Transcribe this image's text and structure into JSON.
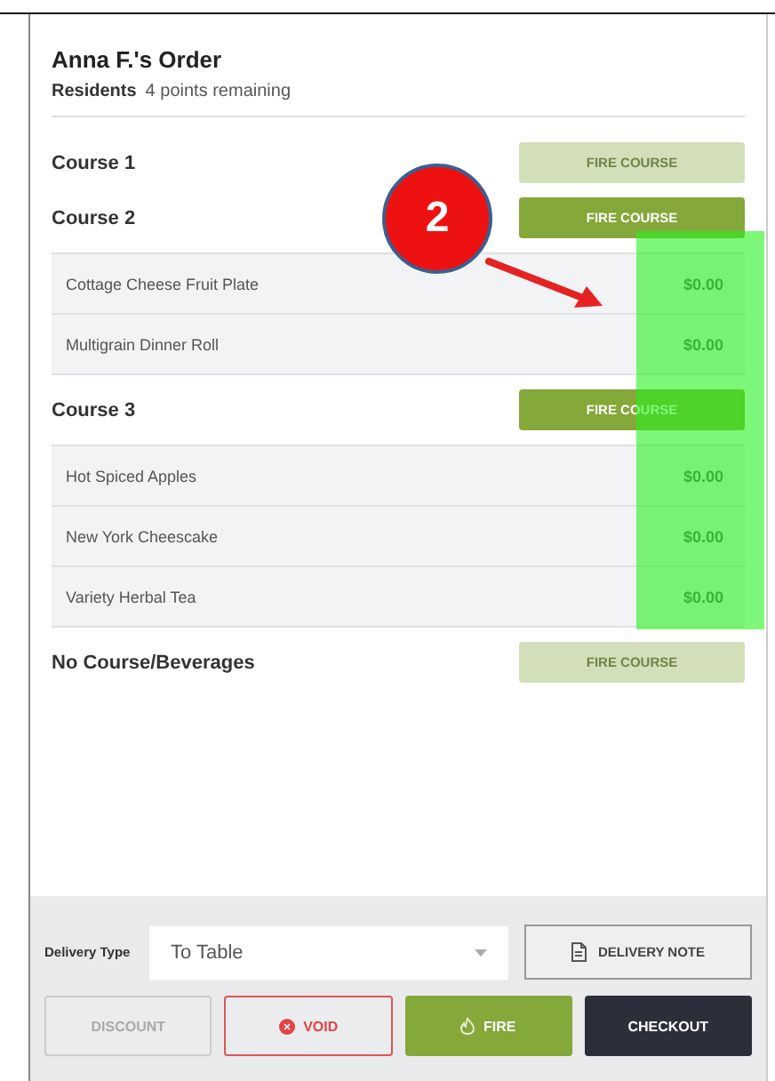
{
  "order": {
    "title": "Anna F.'s Order",
    "group": "Residents",
    "points": "4 points remaining"
  },
  "courses": [
    {
      "name": "Course 1",
      "button": "FIRE COURSE",
      "enabled": false
    },
    {
      "name": "Course 2",
      "button": "FIRE COURSE",
      "enabled": true,
      "items": [
        {
          "name": "Cottage Cheese Fruit Plate",
          "price": "$0.00"
        },
        {
          "name": "Multigrain Dinner Roll",
          "price": "$0.00"
        }
      ]
    },
    {
      "name": "Course 3",
      "button": "FIRE COURSE",
      "enabled": true,
      "items": [
        {
          "name": "Hot Spiced Apples",
          "price": "$0.00"
        },
        {
          "name": "New York Cheescake",
          "price": "$0.00"
        },
        {
          "name": "Variety Herbal Tea",
          "price": "$0.00"
        }
      ]
    },
    {
      "name": "No Course/Beverages",
      "button": "FIRE COURSE",
      "enabled": false
    }
  ],
  "delivery": {
    "label": "Delivery Type",
    "value": "To Table",
    "note_button": "DELIVERY NOTE"
  },
  "actions": [
    {
      "kind": "discount",
      "label": "DISCOUNT",
      "disabled": true
    },
    {
      "kind": "void",
      "label": "VOID",
      "disabled": false
    },
    {
      "kind": "fire",
      "label": "FIRE",
      "disabled": false
    },
    {
      "kind": "checkout",
      "label": "CHECKOUT",
      "disabled": false
    }
  ],
  "annotation": {
    "label": "2"
  }
}
